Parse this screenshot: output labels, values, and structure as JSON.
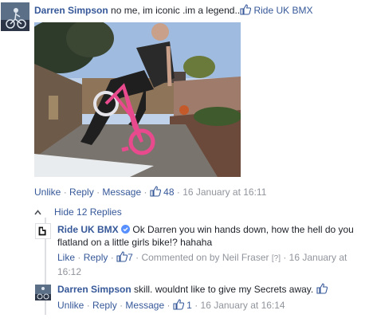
{
  "comment1": {
    "author": "Darren Simpson",
    "text": "no me, im iconic .im a legend..",
    "tagged_page": "Ride UK BMX",
    "actions": {
      "unlike": "Unlike",
      "reply": "Reply",
      "message": "Message",
      "likes": "48",
      "timestamp": "16 January at 16:11"
    }
  },
  "replies_toggle": {
    "label": "Hide 12 Replies"
  },
  "reply1": {
    "author": "Ride UK BMX",
    "text": "Ok Darren you win hands down, how the hell do you flatland on a little girls bike!? hahaha",
    "actions": {
      "like": "Like",
      "reply": "Reply",
      "likes": "7",
      "commented_by": "Commented on by Neil Fraser",
      "help": "[?]",
      "timestamp": "16 January at 16:12"
    }
  },
  "reply2": {
    "author": "Darren Simpson",
    "text": "skill. wouldnt like to give my Secrets away.",
    "actions": {
      "unlike": "Unlike",
      "reply": "Reply",
      "message": "Message",
      "likes": "1",
      "timestamp": "16 January at 16:14"
    }
  },
  "icons": {
    "like": "thumbs-up-icon",
    "verified": "verified-badge-icon",
    "caret": "chevron-up-icon"
  },
  "colors": {
    "link": "#365899",
    "meta": "#90949c",
    "text": "#1d2129"
  }
}
